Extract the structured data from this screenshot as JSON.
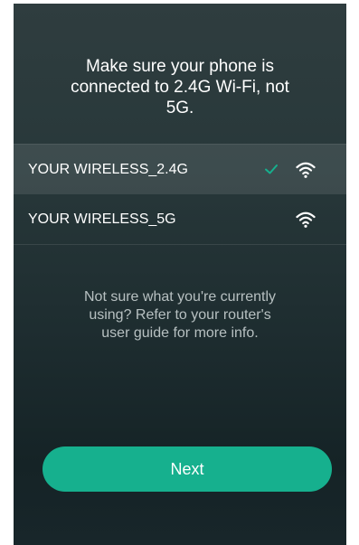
{
  "instruction": {
    "line1": "Make sure your phone is",
    "line2": "connected to 2.4G Wi-Fi, not",
    "line3": "5G."
  },
  "networks": [
    {
      "name": "YOUR WIRELESS_2.4G",
      "selected": true,
      "icons": [
        "check-icon",
        "wifi-icon"
      ]
    },
    {
      "name": "YOUR WIRELESS_5G",
      "selected": false,
      "icons": [
        "wifi-icon"
      ]
    }
  ],
  "help_text": {
    "line1": "Not sure what you're currently",
    "line2": "using? Refer to your router's",
    "line3": "user guide for more info."
  },
  "next_button": {
    "label": "Next"
  },
  "colors": {
    "accent": "#16b08e",
    "background_top": "#2f3d3f",
    "background_bottom": "#152326",
    "help_text": "#b7c0c1"
  }
}
